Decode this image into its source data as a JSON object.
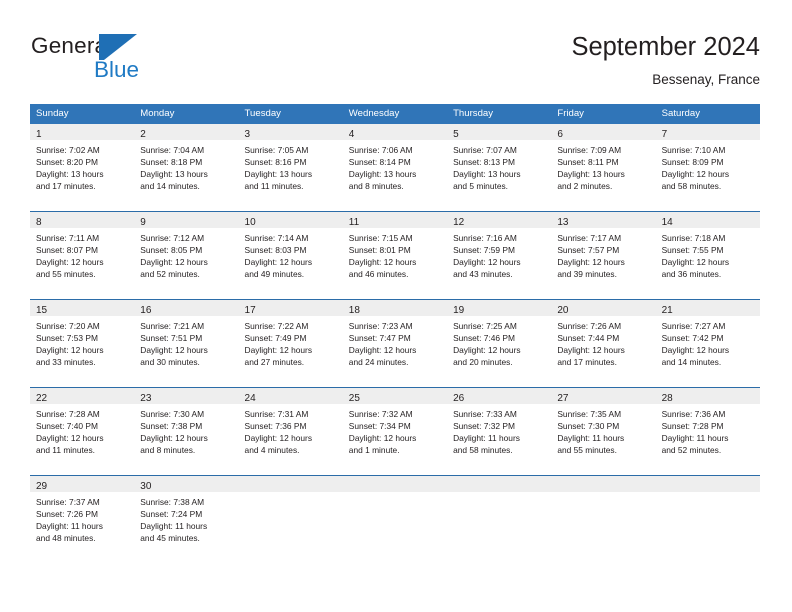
{
  "logo": {
    "text_primary": "General",
    "text_secondary": "Blue",
    "mark_icon": "triangle-flag-icon",
    "color_primary": "#231f20",
    "color_secondary": "#1f7ac4"
  },
  "header": {
    "title": "September 2024",
    "subtitle": "Bessenay, France"
  },
  "colors": {
    "header_blue": "#3075b8",
    "row_divider_blue": "#2b6ca8",
    "daynum_band": "#eeeeee",
    "text": "#231f20"
  },
  "calendar": {
    "weekday_headers": [
      "Sunday",
      "Monday",
      "Tuesday",
      "Wednesday",
      "Thursday",
      "Friday",
      "Saturday"
    ],
    "weeks": [
      [
        {
          "day": "1",
          "sunrise": "Sunrise: 7:02 AM",
          "sunset": "Sunset: 8:20 PM",
          "daylight_line1": "Daylight: 13 hours",
          "daylight_line2": "and 17 minutes."
        },
        {
          "day": "2",
          "sunrise": "Sunrise: 7:04 AM",
          "sunset": "Sunset: 8:18 PM",
          "daylight_line1": "Daylight: 13 hours",
          "daylight_line2": "and 14 minutes."
        },
        {
          "day": "3",
          "sunrise": "Sunrise: 7:05 AM",
          "sunset": "Sunset: 8:16 PM",
          "daylight_line1": "Daylight: 13 hours",
          "daylight_line2": "and 11 minutes."
        },
        {
          "day": "4",
          "sunrise": "Sunrise: 7:06 AM",
          "sunset": "Sunset: 8:14 PM",
          "daylight_line1": "Daylight: 13 hours",
          "daylight_line2": "and 8 minutes."
        },
        {
          "day": "5",
          "sunrise": "Sunrise: 7:07 AM",
          "sunset": "Sunset: 8:13 PM",
          "daylight_line1": "Daylight: 13 hours",
          "daylight_line2": "and 5 minutes."
        },
        {
          "day": "6",
          "sunrise": "Sunrise: 7:09 AM",
          "sunset": "Sunset: 8:11 PM",
          "daylight_line1": "Daylight: 13 hours",
          "daylight_line2": "and 2 minutes."
        },
        {
          "day": "7",
          "sunrise": "Sunrise: 7:10 AM",
          "sunset": "Sunset: 8:09 PM",
          "daylight_line1": "Daylight: 12 hours",
          "daylight_line2": "and 58 minutes."
        }
      ],
      [
        {
          "day": "8",
          "sunrise": "Sunrise: 7:11 AM",
          "sunset": "Sunset: 8:07 PM",
          "daylight_line1": "Daylight: 12 hours",
          "daylight_line2": "and 55 minutes."
        },
        {
          "day": "9",
          "sunrise": "Sunrise: 7:12 AM",
          "sunset": "Sunset: 8:05 PM",
          "daylight_line1": "Daylight: 12 hours",
          "daylight_line2": "and 52 minutes."
        },
        {
          "day": "10",
          "sunrise": "Sunrise: 7:14 AM",
          "sunset": "Sunset: 8:03 PM",
          "daylight_line1": "Daylight: 12 hours",
          "daylight_line2": "and 49 minutes."
        },
        {
          "day": "11",
          "sunrise": "Sunrise: 7:15 AM",
          "sunset": "Sunset: 8:01 PM",
          "daylight_line1": "Daylight: 12 hours",
          "daylight_line2": "and 46 minutes."
        },
        {
          "day": "12",
          "sunrise": "Sunrise: 7:16 AM",
          "sunset": "Sunset: 7:59 PM",
          "daylight_line1": "Daylight: 12 hours",
          "daylight_line2": "and 43 minutes."
        },
        {
          "day": "13",
          "sunrise": "Sunrise: 7:17 AM",
          "sunset": "Sunset: 7:57 PM",
          "daylight_line1": "Daylight: 12 hours",
          "daylight_line2": "and 39 minutes."
        },
        {
          "day": "14",
          "sunrise": "Sunrise: 7:18 AM",
          "sunset": "Sunset: 7:55 PM",
          "daylight_line1": "Daylight: 12 hours",
          "daylight_line2": "and 36 minutes."
        }
      ],
      [
        {
          "day": "15",
          "sunrise": "Sunrise: 7:20 AM",
          "sunset": "Sunset: 7:53 PM",
          "daylight_line1": "Daylight: 12 hours",
          "daylight_line2": "and 33 minutes."
        },
        {
          "day": "16",
          "sunrise": "Sunrise: 7:21 AM",
          "sunset": "Sunset: 7:51 PM",
          "daylight_line1": "Daylight: 12 hours",
          "daylight_line2": "and 30 minutes."
        },
        {
          "day": "17",
          "sunrise": "Sunrise: 7:22 AM",
          "sunset": "Sunset: 7:49 PM",
          "daylight_line1": "Daylight: 12 hours",
          "daylight_line2": "and 27 minutes."
        },
        {
          "day": "18",
          "sunrise": "Sunrise: 7:23 AM",
          "sunset": "Sunset: 7:47 PM",
          "daylight_line1": "Daylight: 12 hours",
          "daylight_line2": "and 24 minutes."
        },
        {
          "day": "19",
          "sunrise": "Sunrise: 7:25 AM",
          "sunset": "Sunset: 7:46 PM",
          "daylight_line1": "Daylight: 12 hours",
          "daylight_line2": "and 20 minutes."
        },
        {
          "day": "20",
          "sunrise": "Sunrise: 7:26 AM",
          "sunset": "Sunset: 7:44 PM",
          "daylight_line1": "Daylight: 12 hours",
          "daylight_line2": "and 17 minutes."
        },
        {
          "day": "21",
          "sunrise": "Sunrise: 7:27 AM",
          "sunset": "Sunset: 7:42 PM",
          "daylight_line1": "Daylight: 12 hours",
          "daylight_line2": "and 14 minutes."
        }
      ],
      [
        {
          "day": "22",
          "sunrise": "Sunrise: 7:28 AM",
          "sunset": "Sunset: 7:40 PM",
          "daylight_line1": "Daylight: 12 hours",
          "daylight_line2": "and 11 minutes."
        },
        {
          "day": "23",
          "sunrise": "Sunrise: 7:30 AM",
          "sunset": "Sunset: 7:38 PM",
          "daylight_line1": "Daylight: 12 hours",
          "daylight_line2": "and 8 minutes."
        },
        {
          "day": "24",
          "sunrise": "Sunrise: 7:31 AM",
          "sunset": "Sunset: 7:36 PM",
          "daylight_line1": "Daylight: 12 hours",
          "daylight_line2": "and 4 minutes."
        },
        {
          "day": "25",
          "sunrise": "Sunrise: 7:32 AM",
          "sunset": "Sunset: 7:34 PM",
          "daylight_line1": "Daylight: 12 hours",
          "daylight_line2": "and 1 minute."
        },
        {
          "day": "26",
          "sunrise": "Sunrise: 7:33 AM",
          "sunset": "Sunset: 7:32 PM",
          "daylight_line1": "Daylight: 11 hours",
          "daylight_line2": "and 58 minutes."
        },
        {
          "day": "27",
          "sunrise": "Sunrise: 7:35 AM",
          "sunset": "Sunset: 7:30 PM",
          "daylight_line1": "Daylight: 11 hours",
          "daylight_line2": "and 55 minutes."
        },
        {
          "day": "28",
          "sunrise": "Sunrise: 7:36 AM",
          "sunset": "Sunset: 7:28 PM",
          "daylight_line1": "Daylight: 11 hours",
          "daylight_line2": "and 52 minutes."
        }
      ],
      [
        {
          "day": "29",
          "sunrise": "Sunrise: 7:37 AM",
          "sunset": "Sunset: 7:26 PM",
          "daylight_line1": "Daylight: 11 hours",
          "daylight_line2": "and 48 minutes."
        },
        {
          "day": "30",
          "sunrise": "Sunrise: 7:38 AM",
          "sunset": "Sunset: 7:24 PM",
          "daylight_line1": "Daylight: 11 hours",
          "daylight_line2": "and 45 minutes."
        },
        {
          "day": "",
          "sunrise": "",
          "sunset": "",
          "daylight_line1": "",
          "daylight_line2": ""
        },
        {
          "day": "",
          "sunrise": "",
          "sunset": "",
          "daylight_line1": "",
          "daylight_line2": ""
        },
        {
          "day": "",
          "sunrise": "",
          "sunset": "",
          "daylight_line1": "",
          "daylight_line2": ""
        },
        {
          "day": "",
          "sunrise": "",
          "sunset": "",
          "daylight_line1": "",
          "daylight_line2": ""
        },
        {
          "day": "",
          "sunrise": "",
          "sunset": "",
          "daylight_line1": "",
          "daylight_line2": ""
        }
      ]
    ]
  }
}
